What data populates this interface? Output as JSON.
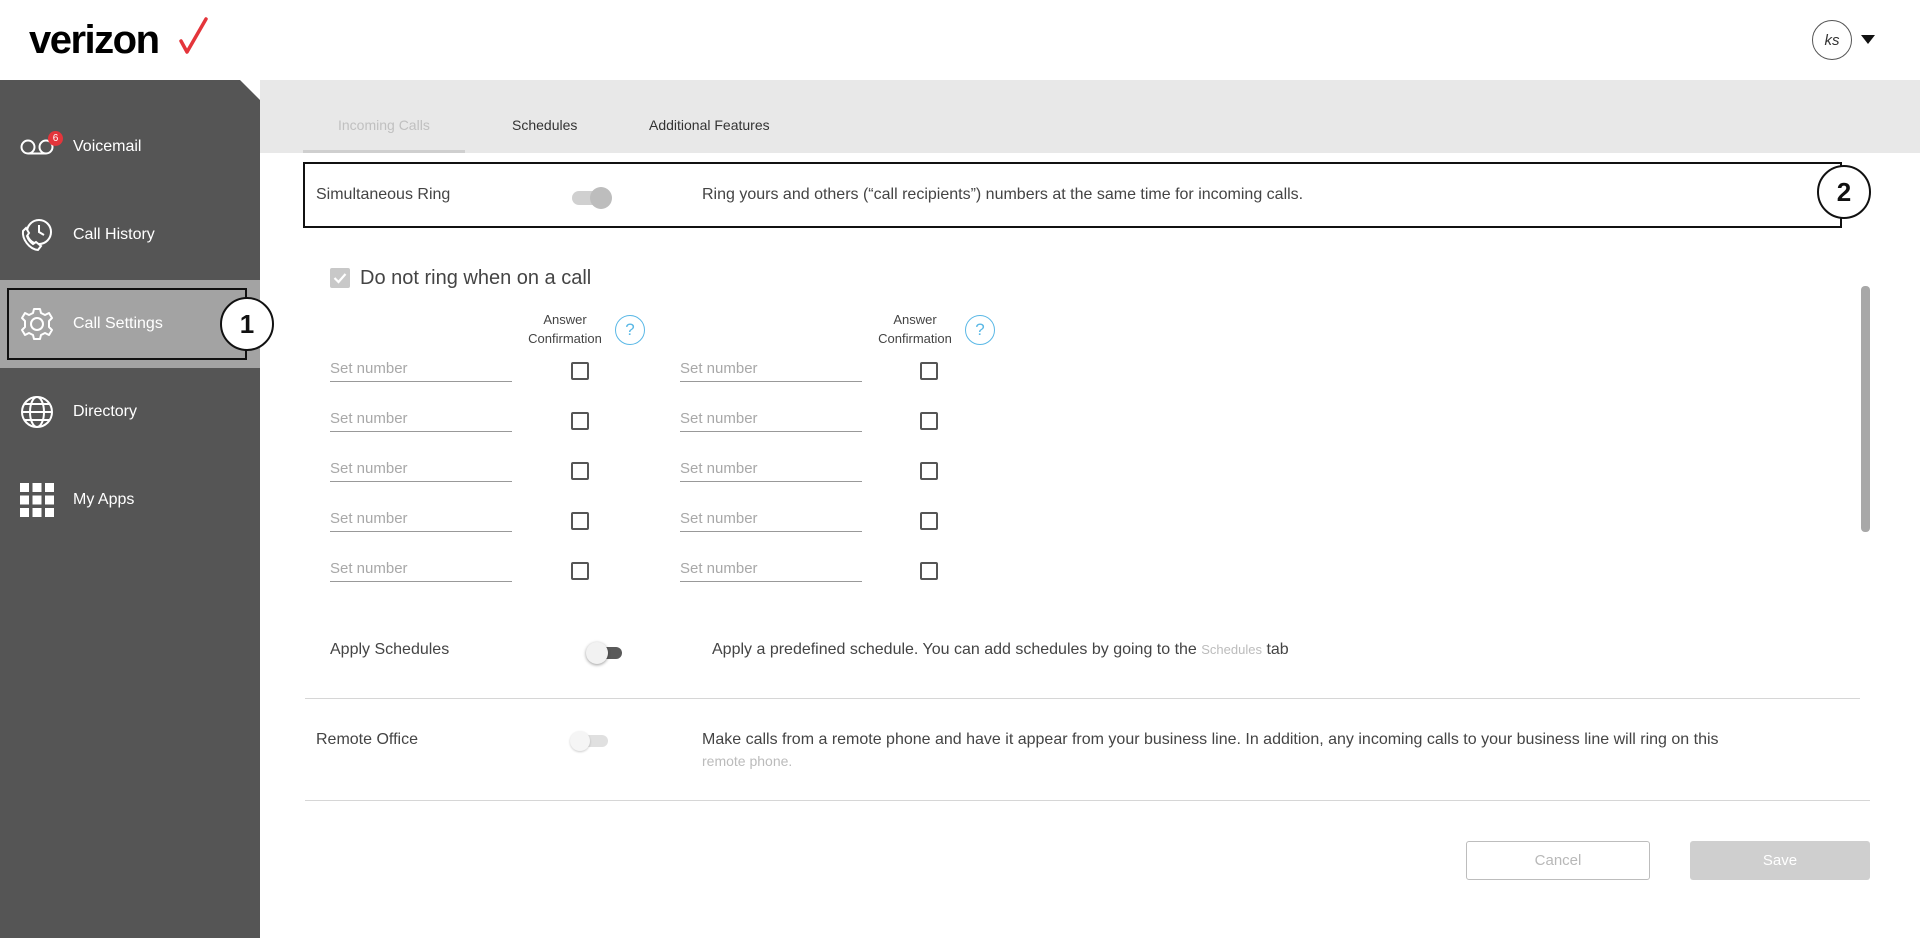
{
  "header": {
    "logo_text": "verizon",
    "avatar_initials": "ks"
  },
  "sidebar": {
    "items": [
      {
        "label": "Voicemail",
        "badge": "6"
      },
      {
        "label": "Call History"
      },
      {
        "label": "Call Settings"
      },
      {
        "label": "Directory"
      },
      {
        "label": "My Apps"
      }
    ]
  },
  "callouts": [
    "1",
    "2"
  ],
  "tabs": [
    {
      "label": "Incoming Calls"
    },
    {
      "label": "Schedules"
    },
    {
      "label": "Additional Features"
    }
  ],
  "simring": {
    "label": "Simultaneous Ring",
    "description": "Ring yours and others (“call recipients”) numbers at the same time for incoming calls.",
    "do_not_ring_label": "Do not ring when on a call",
    "column_header": "Answer Confirmation",
    "column_header_line1": "Answer",
    "column_header_line2": "Confirmation",
    "input_placeholder": "Set number"
  },
  "schedules": {
    "label": "Apply Schedules",
    "description_pre": "Apply a predefined schedule. You can add schedules by going to the",
    "link": "Schedules",
    "description_post": "tab"
  },
  "remote_office": {
    "label": "Remote Office",
    "description_line1": "Make calls from a remote phone and have it appear from your business line. In addition, any incoming calls to your business line will ring on this",
    "description_line2": "remote phone."
  },
  "buttons": {
    "cancel": "Cancel",
    "save": "Save"
  },
  "colors": {
    "sidebar": "#555555",
    "active_nav": "#a3a3a3",
    "brand_red": "#e4353b",
    "help_blue": "#5ab8e6"
  }
}
